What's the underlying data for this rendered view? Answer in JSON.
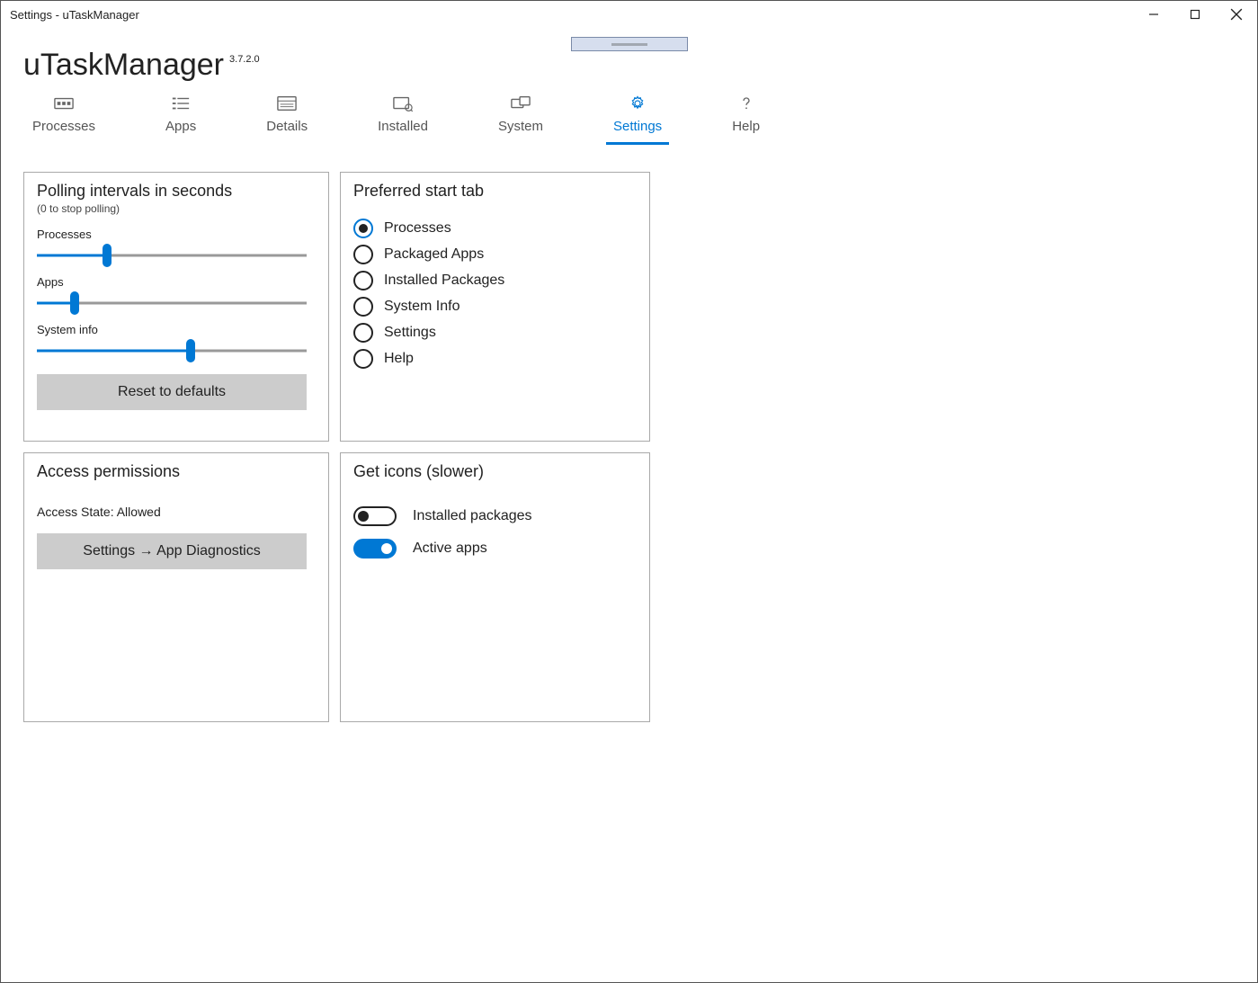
{
  "window": {
    "title": "Settings - uTaskManager"
  },
  "app": {
    "name": "uTaskManager",
    "version": "3.7.2.0"
  },
  "tabs": [
    {
      "id": "processes",
      "label": "Processes",
      "active": false
    },
    {
      "id": "apps",
      "label": "Apps",
      "active": false
    },
    {
      "id": "details",
      "label": "Details",
      "active": false
    },
    {
      "id": "installed",
      "label": "Installed",
      "active": false
    },
    {
      "id": "system",
      "label": "System",
      "active": false
    },
    {
      "id": "settings",
      "label": "Settings",
      "active": true
    },
    {
      "id": "help",
      "label": "Help",
      "active": false
    }
  ],
  "polling": {
    "title": "Polling intervals in seconds",
    "subtitle": "(0 to stop polling)",
    "sliders": {
      "processes": {
        "label": "Processes",
        "percent": 26
      },
      "apps": {
        "label": "Apps",
        "percent": 14
      },
      "system": {
        "label": "System info",
        "percent": 57
      }
    },
    "reset_label": "Reset to defaults"
  },
  "start_tab": {
    "title": "Preferred start tab",
    "options": [
      {
        "label": "Processes",
        "selected": true
      },
      {
        "label": "Packaged Apps",
        "selected": false
      },
      {
        "label": "Installed Packages",
        "selected": false
      },
      {
        "label": "System Info",
        "selected": false
      },
      {
        "label": "Settings",
        "selected": false
      },
      {
        "label": "Help",
        "selected": false
      }
    ]
  },
  "access": {
    "title": "Access permissions",
    "state_label": "Access State:",
    "state_value": "Allowed",
    "button_label": "Settings → App Diagnostics"
  },
  "icons": {
    "title": "Get icons (slower)",
    "toggles": [
      {
        "label": "Installed packages",
        "on": false
      },
      {
        "label": "Active apps",
        "on": true
      }
    ]
  }
}
